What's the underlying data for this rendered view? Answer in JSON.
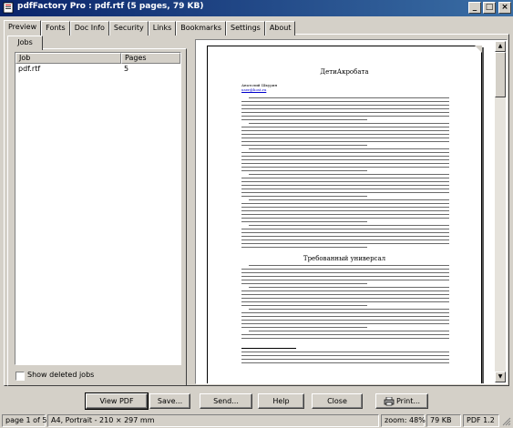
{
  "window": {
    "title": "pdfFactory Pro : pdf.rtf (5 pages, 79 KB)"
  },
  "tabs": [
    "Preview",
    "Fonts",
    "Doc Info",
    "Security",
    "Links",
    "Bookmarks",
    "Settings",
    "About"
  ],
  "jobs_tab": "Jobs",
  "jobs_table": {
    "headers": [
      "Job",
      "Pages"
    ],
    "rows": [
      {
        "job": "pdf.rtf",
        "pages": "5"
      }
    ]
  },
  "show_deleted_jobs": {
    "label": "Show deleted jobs",
    "checked": false
  },
  "preview_page": {
    "title": "ДетиАкробата",
    "author": "Анатолий Шкурин",
    "email": "user@host.ru",
    "section_heading": "Требованный универсал"
  },
  "buttons": [
    "View PDF",
    "Save...",
    "Send...",
    "Help",
    "Close",
    "Print..."
  ],
  "status": {
    "page": "page 1 of 5",
    "paper": "A4, Portrait - 210 × 297 mm",
    "zoom": "zoom: 48%",
    "size": "79 KB",
    "pdf_version": "PDF 1.2"
  }
}
